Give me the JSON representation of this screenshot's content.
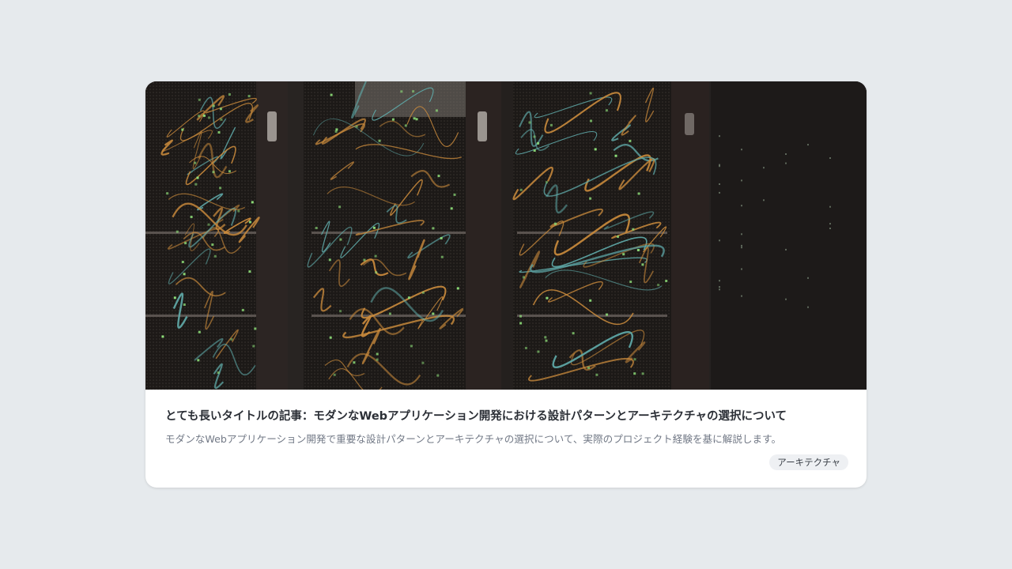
{
  "article_card": {
    "title": "とても長いタイトルの記事：モダンなWebアプリケーション開発における設計パターンとアーキテクチャの選択について",
    "description": "モダンなWebアプリケーション開発で重要な設計パターンとアーキテクチャの選択について、実際のプロジェクト経験を基に解説します。",
    "tag": "アーキテクチャ",
    "thumbnail_icon": "server-rack-photo"
  },
  "colors": {
    "page_background": "#e6eaed",
    "card_background": "#ffffff",
    "title_text": "#2b2f36",
    "description_text": "#727986",
    "tag_background": "#eef0f3",
    "cable_orange": "#c98a3c",
    "cable_teal": "#5fa9a8",
    "led_green": "#8fe07a"
  }
}
